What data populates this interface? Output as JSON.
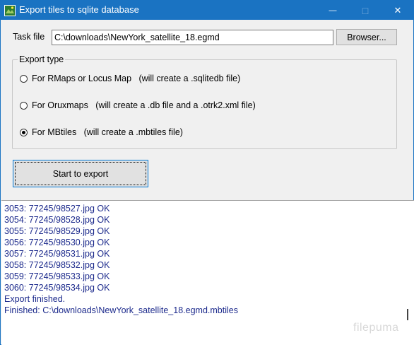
{
  "window": {
    "title": "Export tiles to sqlite database",
    "minimize_glyph": "—",
    "maximize_glyph": "□",
    "close_glyph": "✕"
  },
  "task": {
    "label": "Task file",
    "value": "C:\\downloads\\NewYork_satellite_18.egmd",
    "browse_label": "Browser..."
  },
  "export_type": {
    "legend": "Export type",
    "options": [
      {
        "label": "For RMaps or Locus Map   (will create a .sqlitedb file)",
        "checked": false
      },
      {
        "label": "For Oruxmaps   (will create a .db file and a .otrk2.xml file)",
        "checked": false
      },
      {
        "label": "For MBtiles   (will create a .mbtiles file)",
        "checked": true
      }
    ]
  },
  "start_button": "Start to export",
  "log": {
    "lines": [
      "3053: 77245/98527.jpg OK",
      "3054: 77245/98528.jpg OK",
      "3055: 77245/98529.jpg OK",
      "3056: 77245/98530.jpg OK",
      "3057: 77245/98531.jpg OK",
      "3058: 77245/98532.jpg OK",
      "3059: 77245/98533.jpg OK",
      "3060: 77245/98534.jpg OK",
      "Export finished.",
      "Finished: C:\\downloads\\NewYork_satellite_18.egmd.mbtiles"
    ]
  },
  "watermark": "filepuma",
  "colors": {
    "titlebar": "#1a73c2",
    "log_text": "#1c2a8c"
  },
  "icons": {
    "app": "globe-map-icon",
    "minimize": "minimize-icon",
    "maximize": "maximize-icon",
    "close": "close-icon"
  }
}
